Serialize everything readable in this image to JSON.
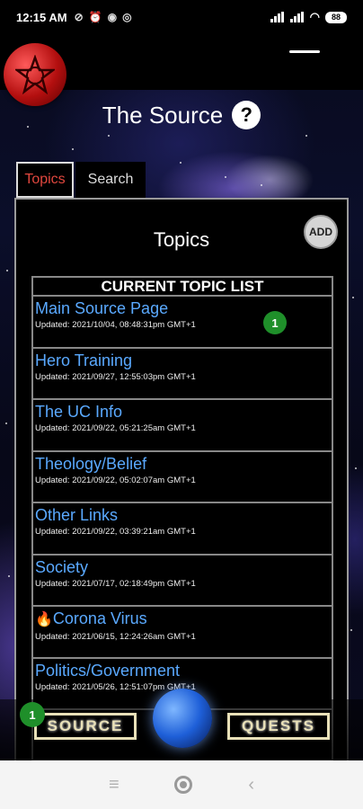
{
  "status_bar": {
    "time": "12:15 AM",
    "battery": "88"
  },
  "header": {
    "title": "The Source",
    "help_icon": "question-icon"
  },
  "tabs": [
    {
      "label": "Topics",
      "active": true
    },
    {
      "label": "Search",
      "active": false
    }
  ],
  "panel": {
    "title": "Topics",
    "add_label": "ADD",
    "list_header": "CURRENT TOPIC LIST"
  },
  "topics": [
    {
      "title": "Main Source Page",
      "updated": "Updated: 2021/10/04, 08:48:31pm GMT+1",
      "badge": "1"
    },
    {
      "title": "Hero Training",
      "updated": "Updated: 2021/09/27, 12:55:03pm GMT+1"
    },
    {
      "title": "The UC Info",
      "updated": "Updated: 2021/09/22, 05:21:25am GMT+1"
    },
    {
      "title": "Theology/Belief",
      "updated": "Updated: 2021/09/22, 05:02:07am GMT+1"
    },
    {
      "title": "Other Links",
      "updated": "Updated: 2021/09/22, 03:39:21am GMT+1"
    },
    {
      "title": "Society",
      "updated": "Updated: 2021/07/17, 02:18:49pm GMT+1"
    },
    {
      "title": "Corona Virus",
      "updated": "Updated: 2021/06/15, 12:24:26am GMT+1",
      "icon": "fire-icon"
    },
    {
      "title": "Politics/Government",
      "updated": "Updated: 2021/05/26, 12:51:07pm GMT+1"
    }
  ],
  "bottom_nav": {
    "source_label": "SOURCE",
    "quests_label": "QUESTS",
    "source_badge": "1"
  },
  "colors": {
    "active_tab": "#e0473e",
    "link": "#5aa9ff",
    "badge": "#1f8f2a"
  }
}
